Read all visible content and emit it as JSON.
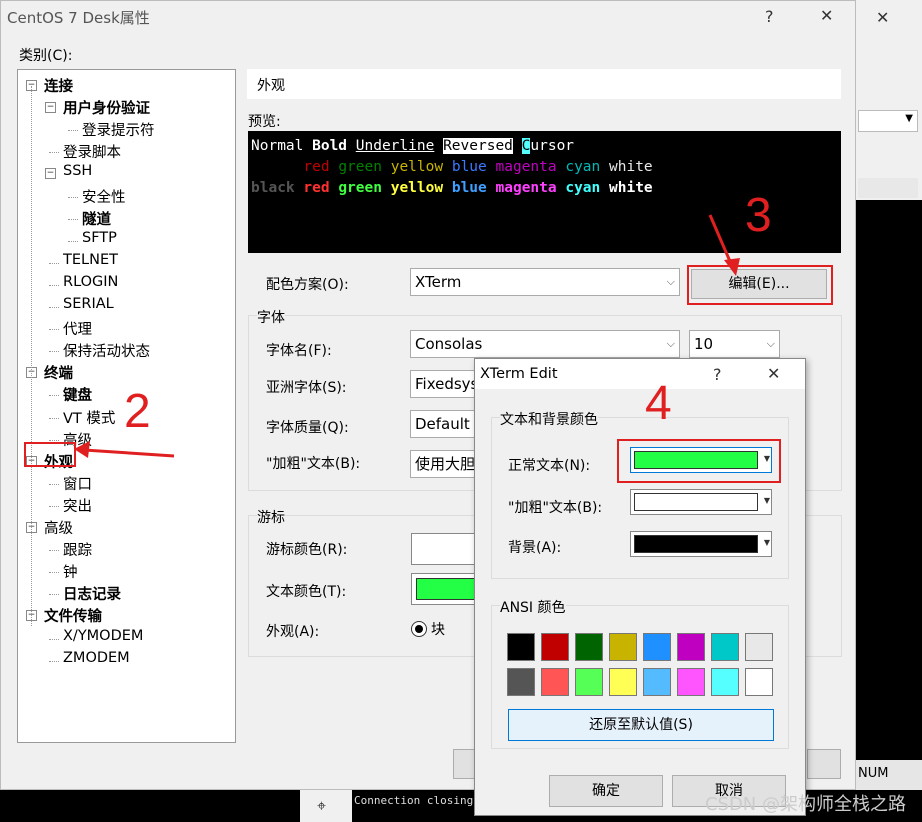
{
  "colors": {
    "accent": "#0078d7",
    "annotation": "#e02020",
    "terminal_bg": "#000000"
  },
  "dialog": {
    "title": "CentOS 7 Desk属性",
    "help": "?",
    "close": "✕",
    "category_label": "类别(C):"
  },
  "tree": [
    {
      "label": "连接",
      "bold": true,
      "expander": "−"
    },
    {
      "label": "用户身份验证",
      "bold": true,
      "expander": "−"
    },
    {
      "label": "登录提示符",
      "bold": false
    },
    {
      "label": "登录脚本",
      "bold": false
    },
    {
      "label": "SSH",
      "bold": false,
      "expander": "−"
    },
    {
      "label": "安全性",
      "bold": false
    },
    {
      "label": "隧道",
      "bold": true
    },
    {
      "label": "SFTP",
      "bold": false
    },
    {
      "label": "TELNET",
      "bold": false
    },
    {
      "label": "RLOGIN",
      "bold": false
    },
    {
      "label": "SERIAL",
      "bold": false
    },
    {
      "label": "代理",
      "bold": false
    },
    {
      "label": "保持活动状态",
      "bold": false
    },
    {
      "label": "终端",
      "bold": true,
      "expander": "−"
    },
    {
      "label": "键盘",
      "bold": true
    },
    {
      "label": "VT 模式",
      "bold": false
    },
    {
      "label": "高级",
      "bold": false
    },
    {
      "label": "外观",
      "bold": true,
      "expander": "−"
    },
    {
      "label": "窗口",
      "bold": false
    },
    {
      "label": "突出",
      "bold": false
    },
    {
      "label": "高级",
      "bold": false,
      "expander": "−"
    },
    {
      "label": "跟踪",
      "bold": false
    },
    {
      "label": "钟",
      "bold": false
    },
    {
      "label": "日志记录",
      "bold": true
    },
    {
      "label": "文件传输",
      "bold": true,
      "expander": "−"
    },
    {
      "label": "X/YMODEM",
      "bold": false
    },
    {
      "label": "ZMODEM",
      "bold": false
    }
  ],
  "section_title": "外观",
  "preview": {
    "label": "预览:",
    "line1": {
      "normal": "Normal ",
      "bold": "Bold",
      "underline": "Underline",
      "reversed": "Reversed",
      "cursor_char": "C",
      "cursor_rest": "ursor"
    },
    "colors_normal": [
      "red",
      "green",
      "yellow",
      "blue",
      "magenta",
      "cyan",
      "white"
    ],
    "black_label": "black",
    "colors_bold": [
      "red",
      "green",
      "yellow",
      "blue",
      "magenta",
      "cyan",
      "white"
    ]
  },
  "scheme": {
    "label": "配色方案(O):",
    "value": "XTerm",
    "edit_button": "编辑(E)..."
  },
  "font": {
    "group": "字体",
    "name_label": "字体名(F):",
    "name_value": "Consolas",
    "size_value": "10",
    "asian_label": "亚洲字体(S):",
    "asian_value": "Fixedsys",
    "quality_label": "字体质量(Q):",
    "quality_value": "Default",
    "bold_label": "\"加粗\"文本(B):",
    "bold_value": "使用大胆"
  },
  "cursor": {
    "group": "游标",
    "color_label": "游标颜色(R):",
    "text_color_label": "文本颜色(T):",
    "appearance_label": "外观(A):",
    "appearance_value": "块"
  },
  "xterm": {
    "title": "XTerm Edit",
    "help": "?",
    "close": "✕",
    "text_bg_group": "文本和背景颜色",
    "normal_text_label": "正常文本(N):",
    "bold_text_label": "\"加粗\"文本(B):",
    "background_label": "背景(A):",
    "ansi_group": "ANSI 颜色",
    "ansi_row1": [
      "#000000",
      "#c00000",
      "#006400",
      "#c8b400",
      "#1e90ff",
      "#c000c0",
      "#00c8c8",
      "#e8e8e8"
    ],
    "ansi_row2": [
      "#555555",
      "#ff5555",
      "#55ff55",
      "#ffff55",
      "#55bbff",
      "#ff55ff",
      "#55ffff",
      "#ffffff"
    ],
    "restore_button": "还原至默认值(S)",
    "ok_button": "确定",
    "cancel_button": "取消"
  },
  "annotations": {
    "n2": "2",
    "n3": "3",
    "n4": "4"
  },
  "background_app": {
    "status": "NUM",
    "terminal_line": "Connection closing.",
    "watermark": "CSDN @架构师全栈之路"
  }
}
